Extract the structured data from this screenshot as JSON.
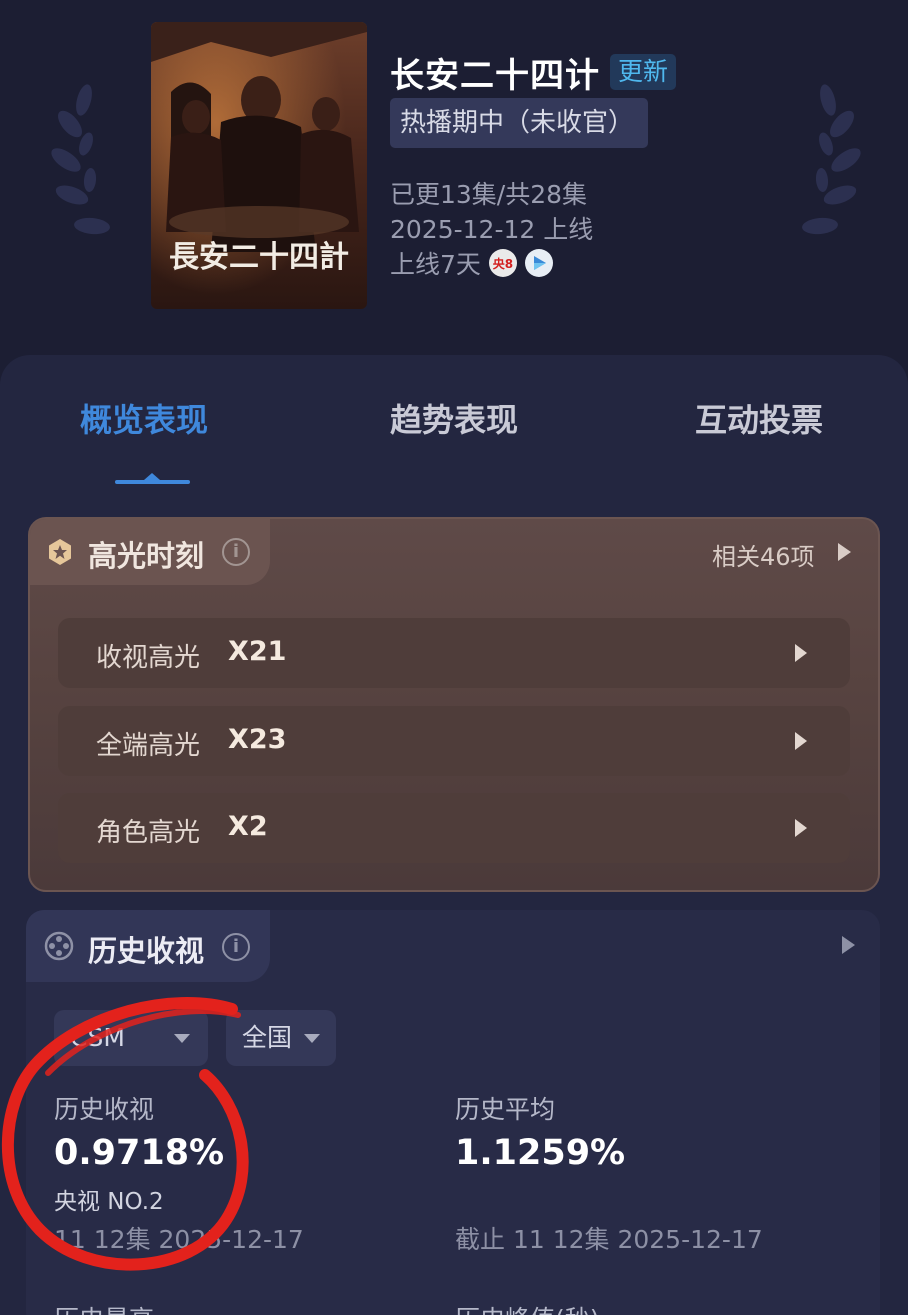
{
  "show": {
    "title": "长安二十四计",
    "update_badge": "更新",
    "status": "热播期中（未收官）",
    "episodes": "已更13集/共28集",
    "premiere": "2025-12-12 上线",
    "days_online": "上线7天",
    "poster_text": "長安二十四計",
    "channels": [
      {
        "name": "cctv8-icon",
        "text": "央8"
      },
      {
        "name": "streaming-icon",
        "text": ""
      }
    ]
  },
  "tabs": [
    {
      "label": "概览表现",
      "active": true
    },
    {
      "label": "趋势表现",
      "active": false
    },
    {
      "label": "互动投票",
      "active": false
    }
  ],
  "highlights": {
    "title": "高光时刻",
    "info": "i",
    "count_label": "相关46项",
    "rows": [
      {
        "label": "收视高光",
        "value": "X21"
      },
      {
        "label": "全端高光",
        "value": "X23"
      },
      {
        "label": "角色高光",
        "value": "X2"
      }
    ]
  },
  "history": {
    "title": "历史收视",
    "info": "i",
    "filters": [
      {
        "value": "CSM"
      },
      {
        "value": "全国"
      }
    ],
    "stats": [
      {
        "label": "历史收视",
        "value": "0.9718%",
        "rank": "央视 NO.2",
        "date": "11 12集 2025-12-17"
      },
      {
        "label": "历史平均",
        "value": "1.1259%",
        "date": "截止 11 12集 2025-12-17"
      }
    ],
    "more_labels": [
      "历史最高",
      "历史峰值(秒)"
    ]
  },
  "colors": {
    "accent": "#3f88dc",
    "background": "#1c1e33",
    "highlight_card": "#574340",
    "annotation": "#e3221c"
  }
}
